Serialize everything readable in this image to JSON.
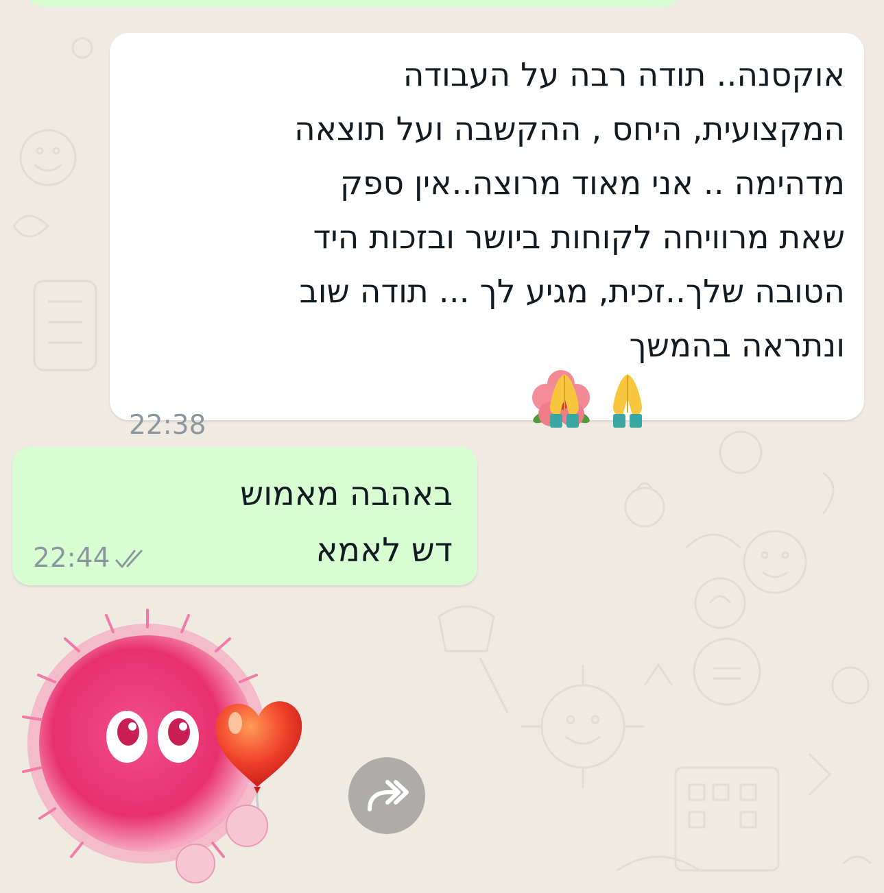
{
  "chat": {
    "messages": [
      {
        "direction": "incoming",
        "text": "אוקסנה.. תודה רבה על העבודה\nהמקצועית, היחס , ההקשבה ועל תוצאה\nמדהימה .. אני מאוד מרוצה..אין ספק\nשאת מרוויחה לקוחות ביושר ובזכות היד\nהטובה שלך..זכית, מגיע לך ... תודה שוב\nונתראה בהמשך",
        "emojis": [
          "folded-hands",
          "folded-hands",
          "hibiscus"
        ],
        "time": "22:38"
      },
      {
        "direction": "outgoing",
        "text": "באהבה מאמוש\nדש לאמא",
        "time": "22:44",
        "status": "read"
      },
      {
        "direction": "outgoing",
        "type": "sticker",
        "sticker": "pink-fluffy-monster-with-heart-balloon"
      }
    ]
  },
  "colors": {
    "chat_background": "#efeae2",
    "incoming_bubble": "#ffffff",
    "outgoing_bubble": "#d9fdd3",
    "timestamp": "#8b969d",
    "forward_button": "#8a8a8a"
  },
  "icons": {
    "read_receipt": "double-check-icon",
    "forward": "forward-icon"
  }
}
